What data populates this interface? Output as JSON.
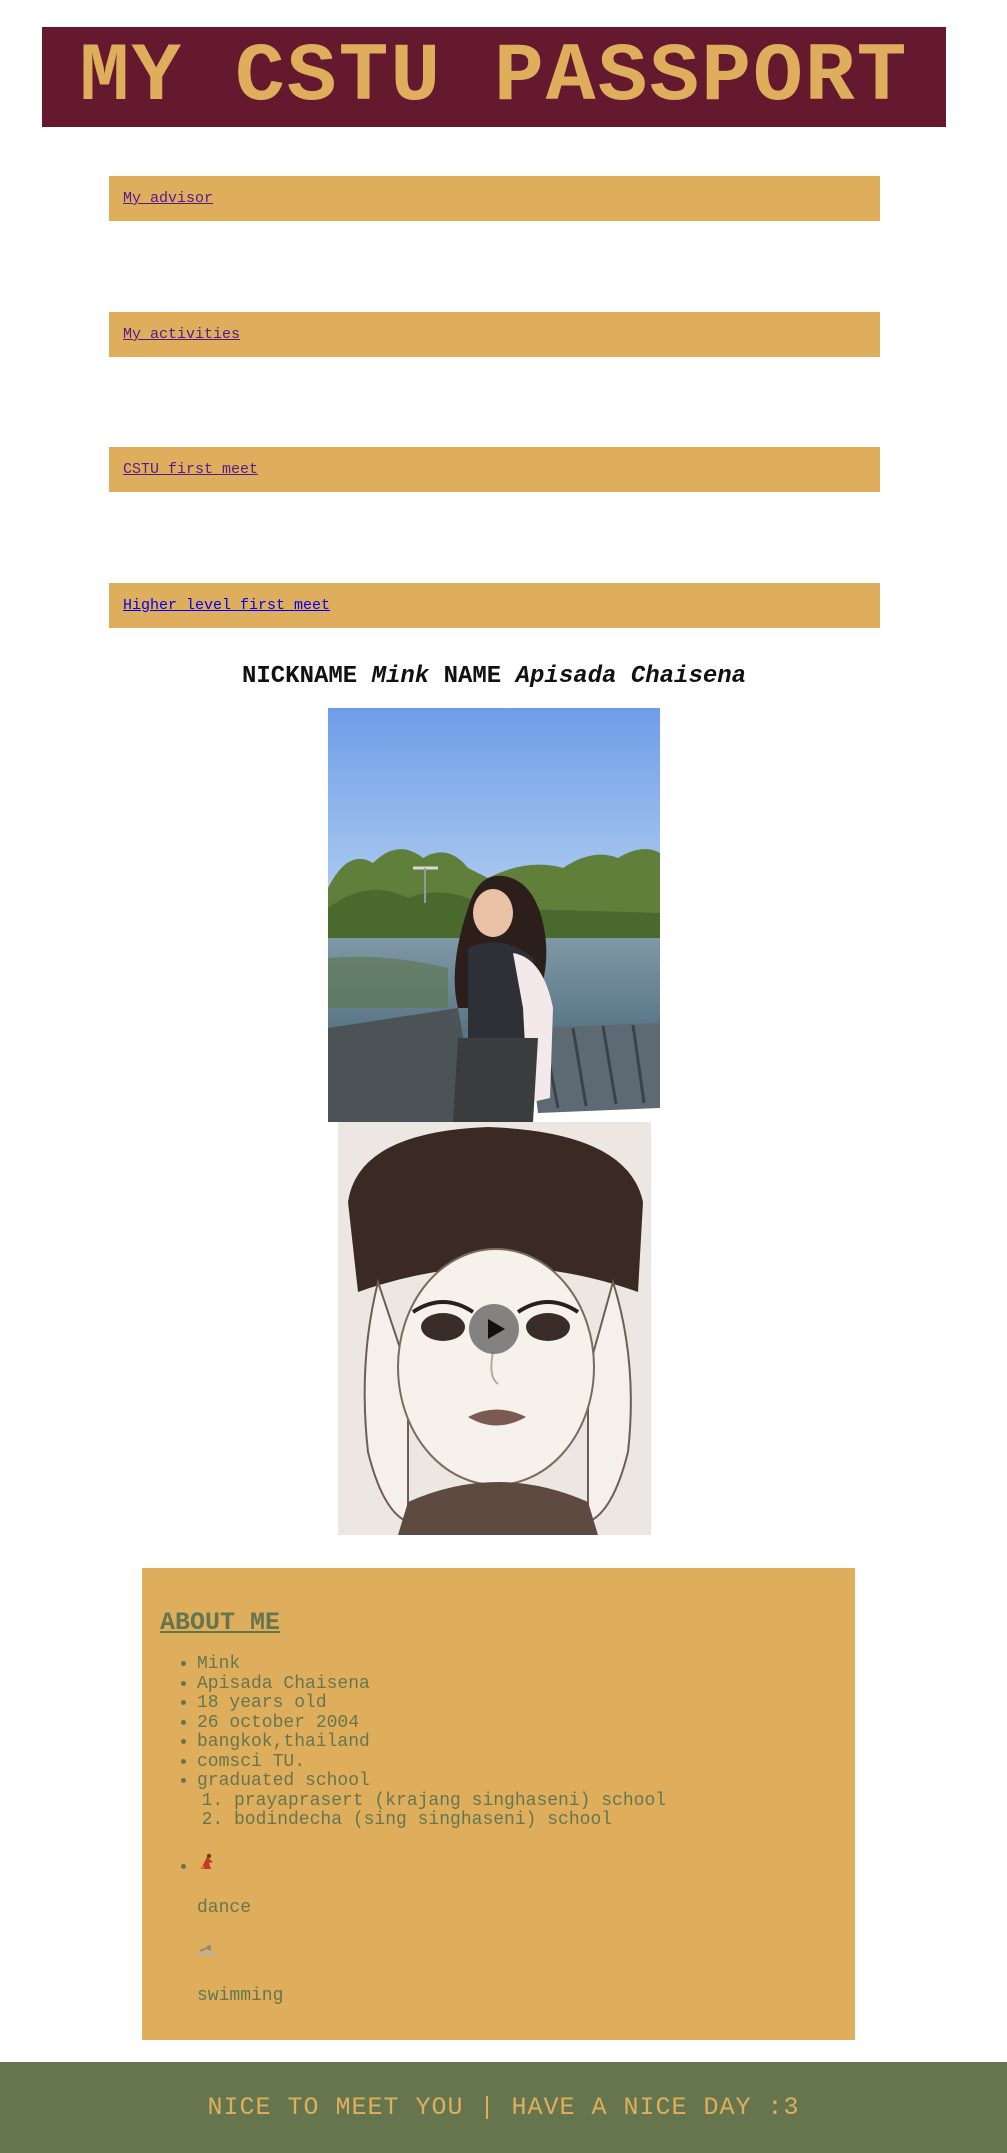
{
  "header": {
    "title": "MY CSTU PASSPORT"
  },
  "nav": {
    "links": [
      {
        "label": "My advisor",
        "state": "visited"
      },
      {
        "label": "My activities",
        "state": "visited"
      },
      {
        "label": "CSTU first meet",
        "state": "visited"
      },
      {
        "label": "Higher level first meet",
        "state": "unvisited"
      }
    ]
  },
  "profile": {
    "nickname_label": "NICKNAME",
    "nickname": "Mink",
    "name_label": "NAME",
    "name": "Apisada Chaisena"
  },
  "media": {
    "photo_icon": "portrait-photo",
    "video_icon": "memoji-video",
    "play_icon": "play-icon"
  },
  "about": {
    "heading": "ABOUT ME",
    "items": [
      "Mink",
      "Apisada Chaisena",
      "18 years old",
      "26 october 2004",
      "bangkok,thailand",
      "comsci TU.",
      "graduated school"
    ],
    "schools": [
      "prayaprasert (krajang singhaseni) school",
      "bodindecha (sing singhaseni) school"
    ],
    "hobbies": [
      {
        "icon": "dancer-icon",
        "label": "dance"
      },
      {
        "icon": "swimmer-icon",
        "label": "swimming"
      }
    ]
  },
  "footer": {
    "text": "NICE TO MEET YOU | HAVE A NICE DAY :3"
  },
  "colors": {
    "maroon": "#65192e",
    "gold": "#dfae5d",
    "olive": "#65764f",
    "visited_link": "#551a8b",
    "link": "#0000ee"
  }
}
